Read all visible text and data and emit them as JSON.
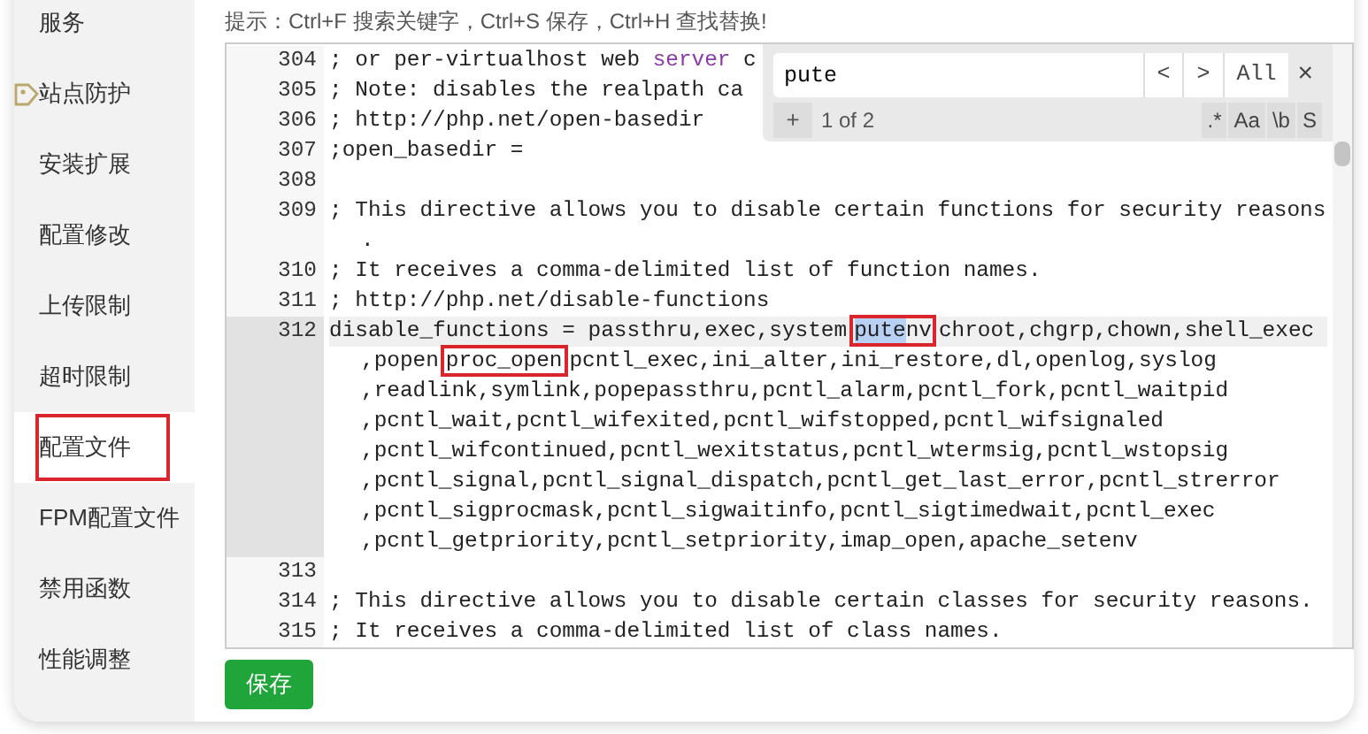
{
  "sidebar": {
    "items": [
      {
        "label": "服务",
        "selected": false,
        "annotated": false,
        "has_icon": false
      },
      {
        "label": "站点防护",
        "selected": false,
        "annotated": false,
        "has_icon": true
      },
      {
        "label": "安装扩展",
        "selected": false,
        "annotated": false,
        "has_icon": false
      },
      {
        "label": "配置修改",
        "selected": false,
        "annotated": false,
        "has_icon": false
      },
      {
        "label": "上传限制",
        "selected": false,
        "annotated": false,
        "has_icon": false
      },
      {
        "label": "超时限制",
        "selected": false,
        "annotated": false,
        "has_icon": false
      },
      {
        "label": "配置文件",
        "selected": true,
        "annotated": true,
        "has_icon": false
      },
      {
        "label": "FPM配置文件",
        "selected": false,
        "annotated": false,
        "has_icon": false
      },
      {
        "label": "禁用函数",
        "selected": false,
        "annotated": false,
        "has_icon": false
      },
      {
        "label": "性能调整",
        "selected": false,
        "annotated": false,
        "has_icon": false
      }
    ]
  },
  "hint": "提示：Ctrl+F 搜索关键字，Ctrl+S 保存，Ctrl+H 查找替换!",
  "editor": {
    "lines": [
      {
        "number": "304",
        "active": false,
        "rows": [
          {
            "segments": [
              {
                "kind": "plain",
                "text": "; or per-virtualhost web "
              },
              {
                "kind": "keyword",
                "text": "server"
              },
              {
                "kind": "plain",
                "text": " c"
              }
            ]
          }
        ]
      },
      {
        "number": "305",
        "active": false,
        "rows": [
          {
            "segments": [
              {
                "kind": "plain",
                "text": "; Note: disables the realpath ca"
              }
            ]
          }
        ]
      },
      {
        "number": "306",
        "active": false,
        "rows": [
          {
            "segments": [
              {
                "kind": "plain",
                "text": "; http://php.net/open-basedir"
              }
            ]
          }
        ]
      },
      {
        "number": "307",
        "active": false,
        "rows": [
          {
            "segments": [
              {
                "kind": "plain",
                "text": ";open_basedir ="
              }
            ]
          }
        ]
      },
      {
        "number": "308",
        "active": false,
        "rows": [
          {
            "segments": []
          }
        ]
      },
      {
        "number": "309",
        "active": false,
        "rows": [
          {
            "segments": [
              {
                "kind": "plain",
                "text": "; This directive allows you to disable certain functions for security reasons"
              }
            ]
          },
          {
            "segments": [
              {
                "kind": "plain",
                "text": "."
              }
            ]
          }
        ]
      },
      {
        "number": "310",
        "active": false,
        "rows": [
          {
            "segments": [
              {
                "kind": "plain",
                "text": "; It receives a comma-delimited list of function names."
              }
            ]
          }
        ]
      },
      {
        "number": "311",
        "active": false,
        "rows": [
          {
            "segments": [
              {
                "kind": "plain",
                "text": "; http://php.net/disable-functions"
              }
            ]
          }
        ]
      },
      {
        "number": "312",
        "active": true,
        "rows": [
          {
            "segments": [
              {
                "kind": "plain",
                "text": "disable_functions = passthru,exec,system"
              },
              {
                "kind": "boxed",
                "parts": [
                  {
                    "kind": "match",
                    "text": "pute"
                  },
                  {
                    "kind": "plain",
                    "text": "nv"
                  }
                ]
              },
              {
                "kind": "plain",
                "text": "chroot,chgrp,chown,shell_exec"
              }
            ]
          },
          {
            "segments": [
              {
                "kind": "plain",
                "text": ",popen"
              },
              {
                "kind": "boxed",
                "parts": [
                  {
                    "kind": "plain",
                    "text": "proc_open"
                  }
                ]
              },
              {
                "kind": "plain",
                "text": "pcntl_exec,ini_alter,ini_restore,dl,openlog,syslog"
              }
            ]
          },
          {
            "segments": [
              {
                "kind": "plain",
                "text": ",readlink,symlink,popepassthru,pcntl_alarm,pcntl_fork,pcntl_waitpid"
              }
            ]
          },
          {
            "segments": [
              {
                "kind": "plain",
                "text": ",pcntl_wait,pcntl_wifexited,pcntl_wifstopped,pcntl_wifsignaled"
              }
            ]
          },
          {
            "segments": [
              {
                "kind": "plain",
                "text": ",pcntl_wifcontinued,pcntl_wexitstatus,pcntl_wtermsig,pcntl_wstopsig"
              }
            ]
          },
          {
            "segments": [
              {
                "kind": "plain",
                "text": ",pcntl_signal,pcntl_signal_dispatch,pcntl_get_last_error,pcntl_strerror"
              }
            ]
          },
          {
            "segments": [
              {
                "kind": "plain",
                "text": ",pcntl_sigprocmask,pcntl_sigwaitinfo,pcntl_sigtimedwait,pcntl_exec"
              }
            ]
          },
          {
            "segments": [
              {
                "kind": "plain",
                "text": ",pcntl_getpriority,pcntl_setpriority,imap_open,apache_setenv"
              }
            ]
          }
        ]
      },
      {
        "number": "313",
        "active": false,
        "rows": [
          {
            "segments": []
          }
        ]
      },
      {
        "number": "314",
        "active": false,
        "rows": [
          {
            "segments": [
              {
                "kind": "plain",
                "text": "; This directive allows you to disable certain classes for security reasons."
              }
            ]
          }
        ]
      },
      {
        "number": "315",
        "active": false,
        "rows": [
          {
            "segments": [
              {
                "kind": "plain",
                "text": "; It receives a comma-delimited list of class names."
              }
            ]
          }
        ]
      }
    ],
    "search": {
      "query": "pute",
      "nav_buttons": [
        "<",
        ">",
        "All"
      ],
      "close": "×",
      "add": "+",
      "count": "1 of 2",
      "toggles": [
        ".*",
        "Aa",
        "\\b",
        "S"
      ]
    }
  },
  "save_button": "保存"
}
